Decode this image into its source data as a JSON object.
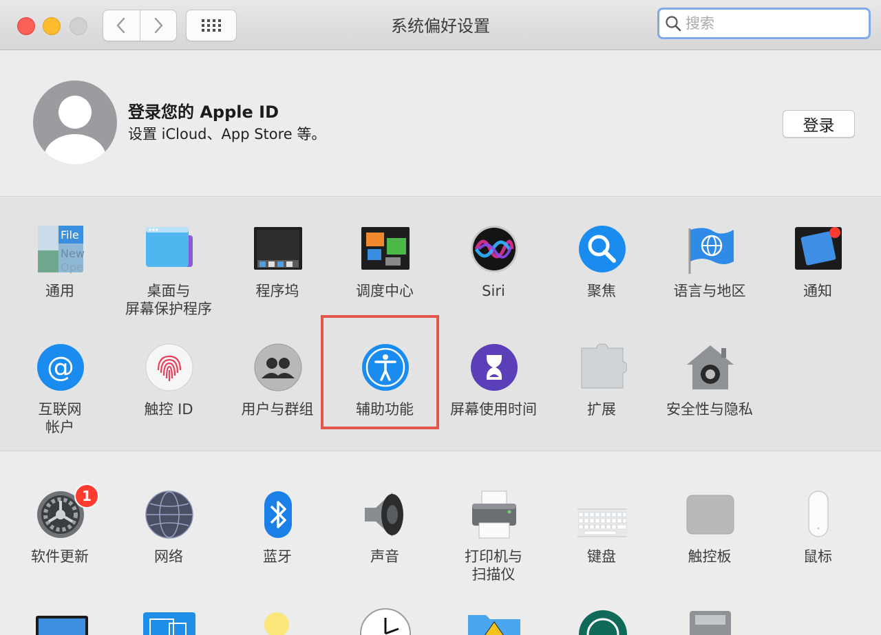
{
  "window": {
    "title": "系统偏好设置"
  },
  "search": {
    "placeholder": "搜索"
  },
  "account": {
    "title": "登录您的 Apple ID",
    "subtitle": "设置 iCloud、App Store 等。",
    "login_button": "登录"
  },
  "row1": [
    {
      "label": "通用",
      "icon": "general-icon"
    },
    {
      "label": "桌面与\n屏幕保护程序",
      "icon": "desktop-icon"
    },
    {
      "label": "程序坞",
      "icon": "dock-icon"
    },
    {
      "label": "调度中心",
      "icon": "mission-control-icon"
    },
    {
      "label": "Siri",
      "icon": "siri-icon"
    },
    {
      "label": "聚焦",
      "icon": "spotlight-icon"
    },
    {
      "label": "语言与地区",
      "icon": "language-region-icon"
    },
    {
      "label": "通知",
      "icon": "notifications-icon"
    }
  ],
  "row2": [
    {
      "label": "互联网\n帐户",
      "icon": "internet-accounts-icon"
    },
    {
      "label": "触控 ID",
      "icon": "touch-id-icon"
    },
    {
      "label": "用户与群组",
      "icon": "users-groups-icon"
    },
    {
      "label": "辅助功能",
      "icon": "accessibility-icon"
    },
    {
      "label": "屏幕使用时间",
      "icon": "screen-time-icon"
    },
    {
      "label": "扩展",
      "icon": "extensions-icon"
    },
    {
      "label": "安全性与隐私",
      "icon": "security-privacy-icon"
    }
  ],
  "row3": [
    {
      "label": "软件更新",
      "icon": "software-update-icon",
      "badge": "1"
    },
    {
      "label": "网络",
      "icon": "network-icon"
    },
    {
      "label": "蓝牙",
      "icon": "bluetooth-icon"
    },
    {
      "label": "声音",
      "icon": "sound-icon"
    },
    {
      "label": "打印机与\n扫描仪",
      "icon": "printers-scanners-icon"
    },
    {
      "label": "键盘",
      "icon": "keyboard-icon"
    },
    {
      "label": "触控板",
      "icon": "trackpad-icon"
    },
    {
      "label": "鼠标",
      "icon": "mouse-icon"
    }
  ],
  "colors": {
    "highlight": "#e5564a",
    "accent": "#1a8cf0",
    "badge": "#ff3b30"
  }
}
